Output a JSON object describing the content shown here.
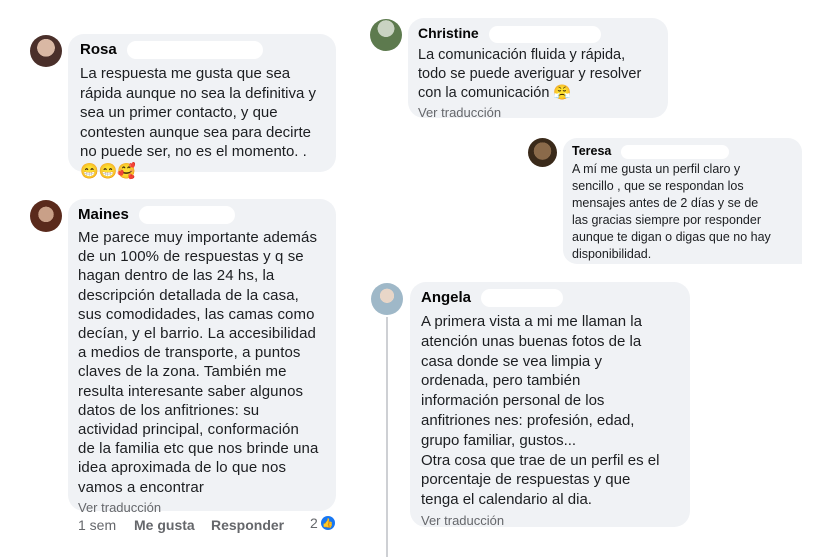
{
  "comments": {
    "rosa": {
      "name": "Rosa",
      "text": "La respuesta me gusta que sea\nrápida aunque no sea la definitiva y\nsea un primer contacto, y que\ncontesten aunque sea para decirte\nno puede ser, no es el momento. .",
      "emojis": "😁😁🥰"
    },
    "maines": {
      "name": "Maines",
      "text": "Me parece muy importante además\nde un 100% de respuestas y q se\nhagan dentro de las 24 hs, la\ndescripción detallada de la casa,\nsus comodidades, las camas como\ndecían, y el barrio. La accesibilidad\na medios de transporte, a puntos\nclaves de la zona. También me\nresulta interesante saber algunos\ndatos de los anfitriones: su\nactividad principal, conformación\nde la familia etc que nos brinde una\nidea aproximada de lo que nos\nvamos a encontrar",
      "translate": "Ver traducción",
      "time": "1 sem",
      "like": "Me gusta",
      "reply": "Responder",
      "reactions": "2"
    },
    "christine": {
      "name": "Christine",
      "text": "La comunicación fluida y rápida,\ntodo se puede averiguar y resolver\ncon la comunicación",
      "emoji": "😤",
      "translate": "Ver traducción"
    },
    "teresa": {
      "name": "Teresa",
      "text": "A mí me gusta un perfil claro y\nsencillo , que se respondan los\nmensajes antes de 2 días y se de\nlas gracias siempre por responder\naunque te digan o  digas que no hay\ndisponibilidad."
    },
    "angela": {
      "name": "Angela",
      "text": "A primera vista a mi me llaman  la\natención  unas buenas fotos de la\ncasa donde se vea limpia y\nordenada, pero también\ninformación personal de los\nanfitriones nes: profesión, edad,\ngrupo familiar, gustos...\nOtra cosa que trae de un perfil es el\nporcentaje de respuestas y que\ntenga el calendario al dia.",
      "translate": "Ver traducción"
    }
  },
  "colors": {
    "bubble": "#f0f2f5",
    "meta": "#65676b",
    "like_blue": "#1877f2"
  },
  "icons": {
    "reaction": "like-icon"
  }
}
